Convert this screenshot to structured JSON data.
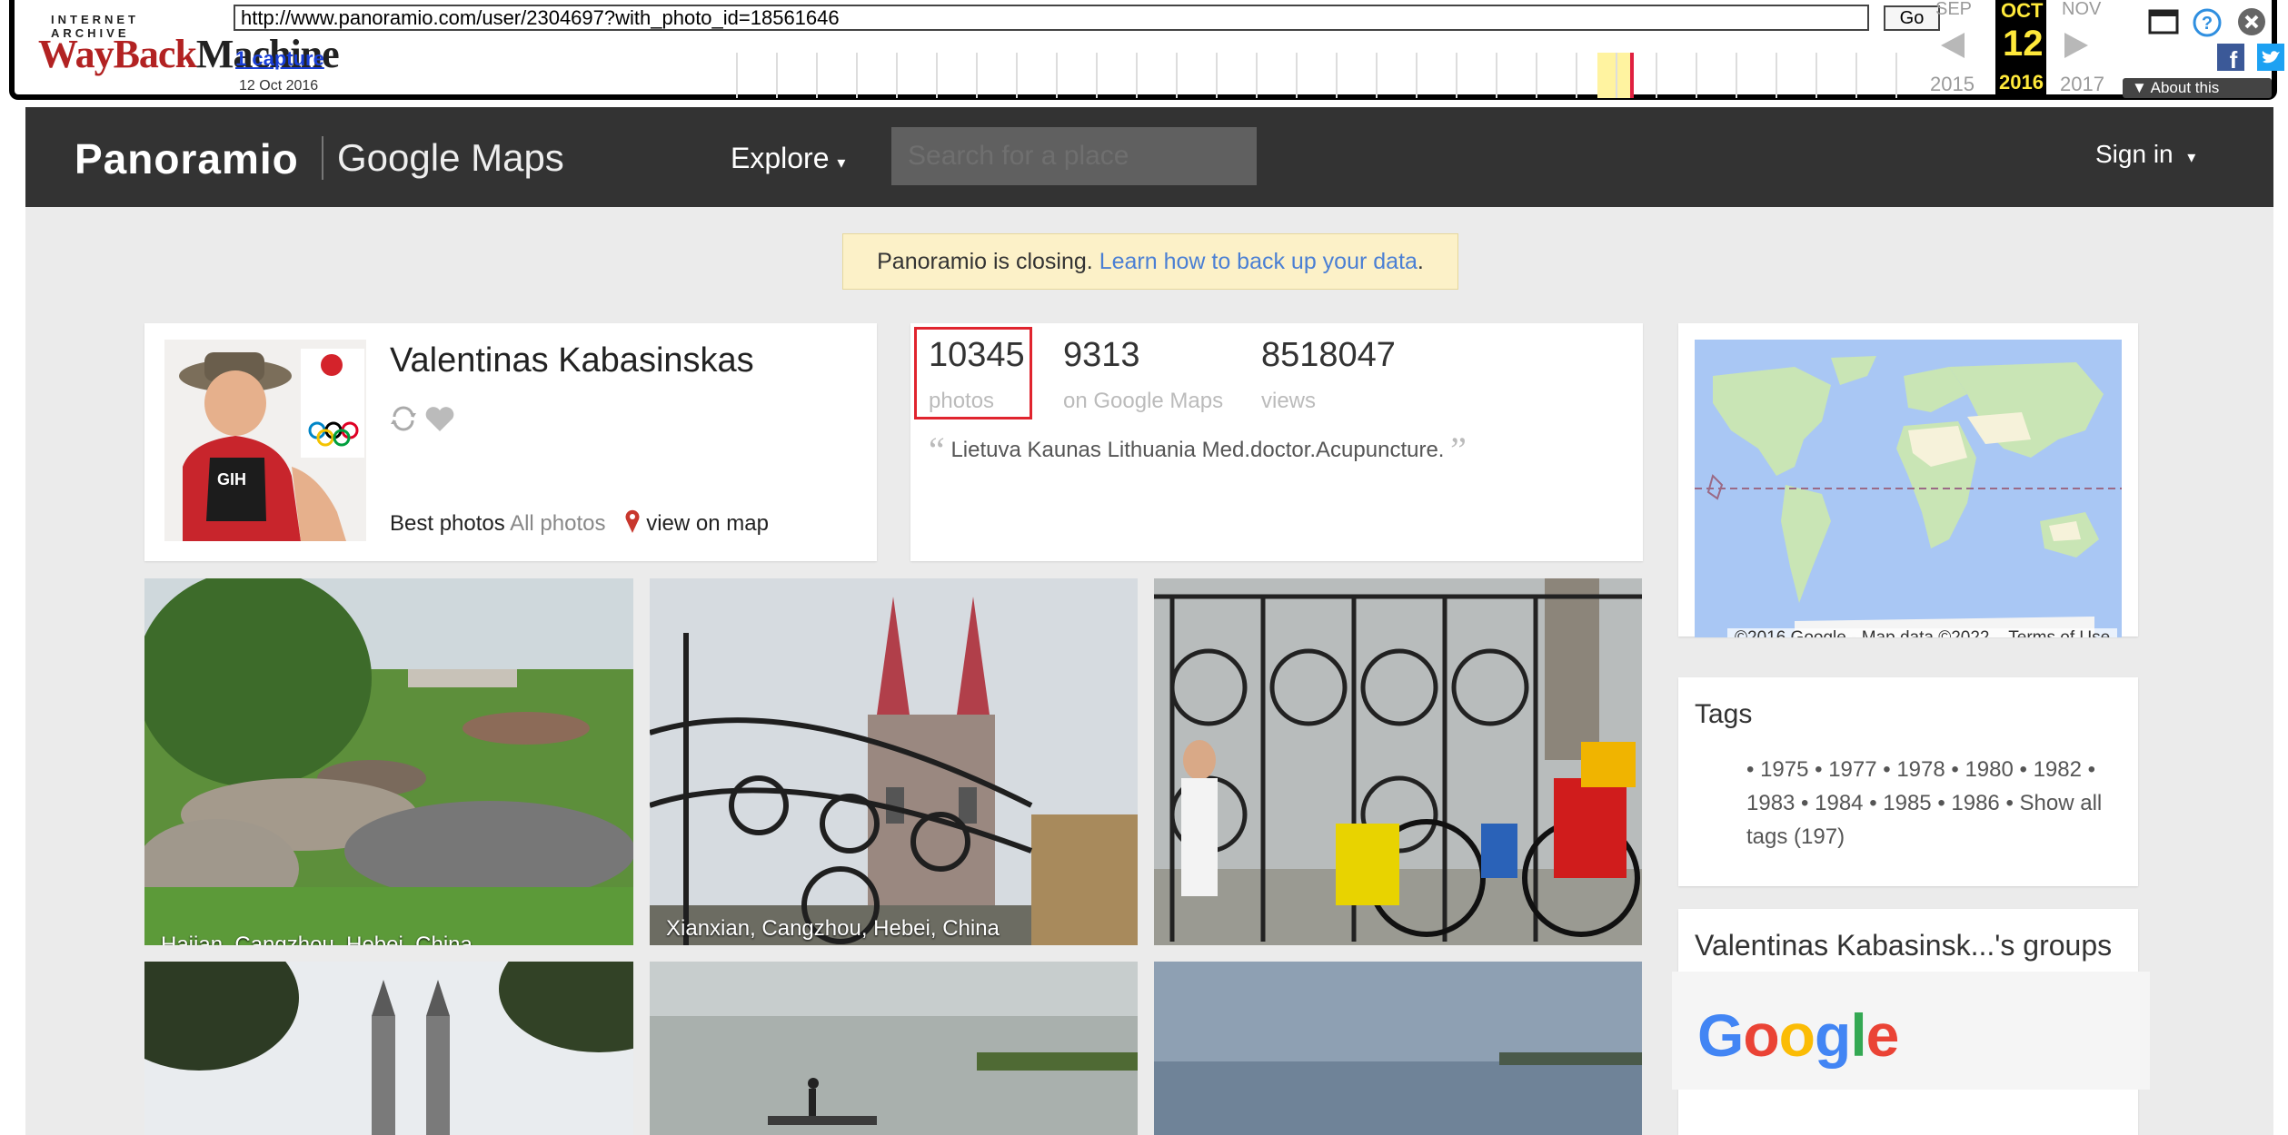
{
  "wayback": {
    "logo_top": "INTERNET ARCHIVE",
    "logo_way": "WayBack",
    "logo_machine": "Machine",
    "url": "http://www.panoramio.com/user/2304697?with_photo_id=18561646",
    "go_label": "Go",
    "captures": "1 capture",
    "capture_date": "12 Oct 2016",
    "prev_month": "SEP",
    "cur_month": "OCT",
    "next_month": "NOV",
    "cur_day": "12",
    "prev_year": "2015",
    "cur_year": "2016",
    "next_year": "2017",
    "about": "About this capture",
    "icons": [
      "window-icon",
      "help-icon",
      "close-icon",
      "facebook-icon",
      "twitter-icon"
    ]
  },
  "nav": {
    "brand": "Panoramio",
    "brand_sub": "Google Maps",
    "explore": "Explore",
    "search_placeholder": "Search for a place",
    "signin": "Sign in"
  },
  "notice": {
    "text": "Panoramio is closing. ",
    "link": "Learn how to back up your data",
    "tail": "."
  },
  "profile": {
    "name": "Valentinas Kabasinskas",
    "best_photos": "Best photos",
    "all_photos": "All photos",
    "view_on_map": "view on map"
  },
  "stats": {
    "photos_count": "10345",
    "photos_label": "photos",
    "gm_count": "9313",
    "gm_label": "on Google Maps",
    "views_count": "8518047",
    "views_label": "views",
    "quote": "Lietuva Kaunas Lithuania Med.doctor.Acupuncture."
  },
  "map": {
    "attribution": "©2016 Google - Map data ©2022",
    "terms": "Terms of Use"
  },
  "tags": {
    "title": "Tags",
    "items": "• 1975 • 1977 • 1978 • 1980 • 1982 • 1983 • 1984 • 1985 • 1986 • Show all tags (197)"
  },
  "groups": {
    "title": "Valentinas Kabasinsk...'s groups",
    "google": "Google"
  },
  "photos": [
    {
      "caption": "Haijan, Cangzhou, Hebei, China"
    },
    {
      "caption": "Xianxian, Cangzhou, Hebei, China"
    },
    {
      "caption": ""
    }
  ],
  "colors": {
    "navbar": "#333333",
    "accent_red": "#e0242e",
    "link_blue": "#4a7fd4",
    "notice_bg": "#fcf1c8"
  }
}
